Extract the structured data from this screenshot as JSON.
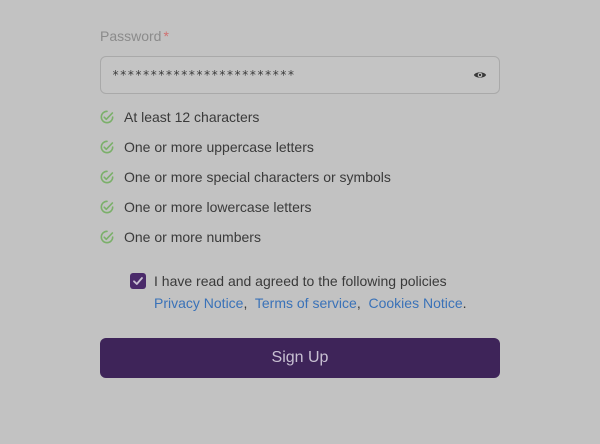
{
  "password": {
    "label": "Password",
    "required_mark": "*",
    "value": "************************",
    "toggle_icon": "eye-icon"
  },
  "requirements": [
    {
      "text": "At least 12 characters",
      "met": true
    },
    {
      "text": "One or more uppercase letters",
      "met": true
    },
    {
      "text": "One or more special characters or symbols",
      "met": true
    },
    {
      "text": "One or more lowercase letters",
      "met": true
    },
    {
      "text": "One or more numbers",
      "met": true
    }
  ],
  "policy": {
    "checked": true,
    "text": "I have read and agreed to the following policies",
    "links": [
      "Privacy Notice",
      "Terms of service",
      "Cookies Notice"
    ],
    "separator": ",",
    "terminator": "."
  },
  "signup": {
    "label": "Sign Up"
  },
  "colors": {
    "background": "#c2c2c2",
    "primary": "#3e2459",
    "link": "#3a72b8",
    "check": "#7bb06a",
    "required": "#d07070"
  }
}
